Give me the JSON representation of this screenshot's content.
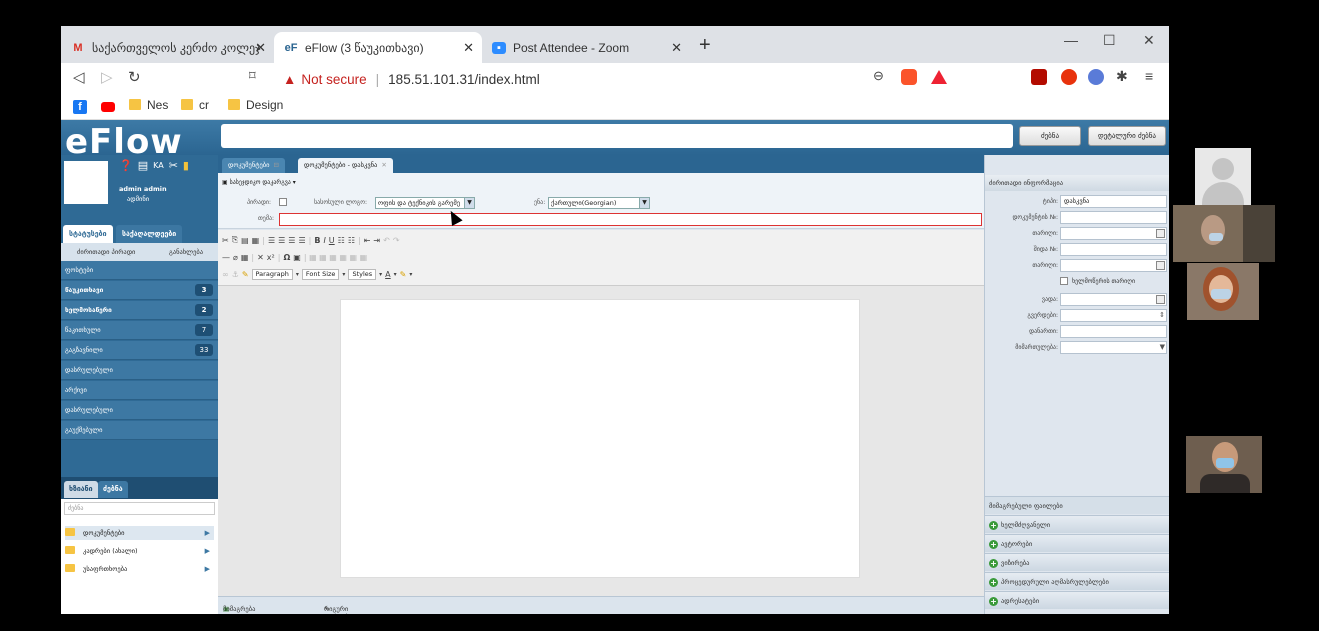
{
  "browser": {
    "tabs": [
      {
        "title": "საქართველოს კერძო კოლეჯ",
        "icon": "gmail-icon"
      },
      {
        "title": "eFlow (3 წაუკითხავი)",
        "icon": "eflow-icon"
      },
      {
        "title": "Post Attendee - Zoom",
        "icon": "zoom-icon"
      }
    ],
    "new_tab": "+",
    "window": {
      "minimize": "—",
      "maximize": "☐",
      "close": "✕"
    },
    "address": {
      "warning": "Not secure",
      "url": "185.51.101.31/index.html"
    },
    "bookmarks": [
      "Nes",
      "cr",
      "Design"
    ]
  },
  "app": {
    "logo": "eFlow",
    "header_buttons": {
      "search": "ძებნა",
      "advanced_search": "დეტალური ძებნა"
    },
    "user": {
      "name": "admin admin",
      "role": "ადმინი",
      "lang": "KA"
    },
    "left_tabs": [
      "სტატუსები",
      "საქაღალდეები"
    ],
    "left_subtabs": [
      "ძირითადი პირადი",
      "განახლება"
    ],
    "left_items": [
      {
        "label": "ფოსტები",
        "count": ""
      },
      {
        "label": "წაუკითხავი",
        "count": "3"
      },
      {
        "label": "ხელმოსაწერი",
        "count": "2"
      },
      {
        "label": "წაკითხული",
        "count": "7"
      },
      {
        "label": "გაგზავნილი",
        "count": "33"
      },
      {
        "label": "დასრულებული",
        "count": ""
      },
      {
        "label": "არქივი",
        "count": ""
      },
      {
        "label": "დასრულებული",
        "count": ""
      },
      {
        "label": "გაუქმებული",
        "count": ""
      }
    ],
    "lower_tabs": [
      "ხზიანი",
      "ძებნა"
    ],
    "tree_search_placeholder": "ძებნა",
    "tree": [
      "დოკუმენტები",
      "კადრები (ახალი)",
      "უსაფრთხოება"
    ],
    "doc_tabs": [
      "დოკუმენტები",
      "დოკუმენტები - დასკვნა"
    ],
    "form": {
      "save_menu": "სასეჯდიკო დაკარგვა",
      "label_private": "პირადი:",
      "label_template": "სასოსული ლოგო:",
      "template_value": "ოფის და ტექნიკის გარემე",
      "label_lang": "ენა:",
      "lang_value": "ქართული(Georgian)",
      "label_subject": "თემა:"
    },
    "editor": {
      "paragraph": "Paragraph",
      "font_size": "Font Size",
      "styles": "Styles"
    },
    "footer": {
      "attach": "მიმაგრება და გადაგზავნა",
      "history": "რიგური ფოსტები"
    },
    "right": {
      "header": "ძირითადი ინფორმაცია",
      "fields": [
        {
          "label": "ტიპი:",
          "value": "დასკვნა"
        },
        {
          "label": "დოკუმენტის №:",
          "value": ""
        },
        {
          "label": "თარიღი:",
          "value": ""
        },
        {
          "label": "შიდა №:",
          "value": ""
        },
        {
          "label": "თარიღი:",
          "value": ""
        }
      ],
      "checkbox_label": "ხელმოწერის თარიღი",
      "fields2": [
        {
          "label": "ვადა:",
          "value": ""
        },
        {
          "label": "გვერდები:",
          "value": ""
        },
        {
          "label": "დანართი:",
          "value": ""
        },
        {
          "label": "მიმართულება:",
          "value": ""
        }
      ],
      "sections": [
        "მიმაგრებული ფაილები",
        "ხელმძღვანელი",
        "ავტორები",
        "ვიზირება",
        "პროცედურული აღმასრულებლები",
        "ადრესატები"
      ]
    }
  }
}
